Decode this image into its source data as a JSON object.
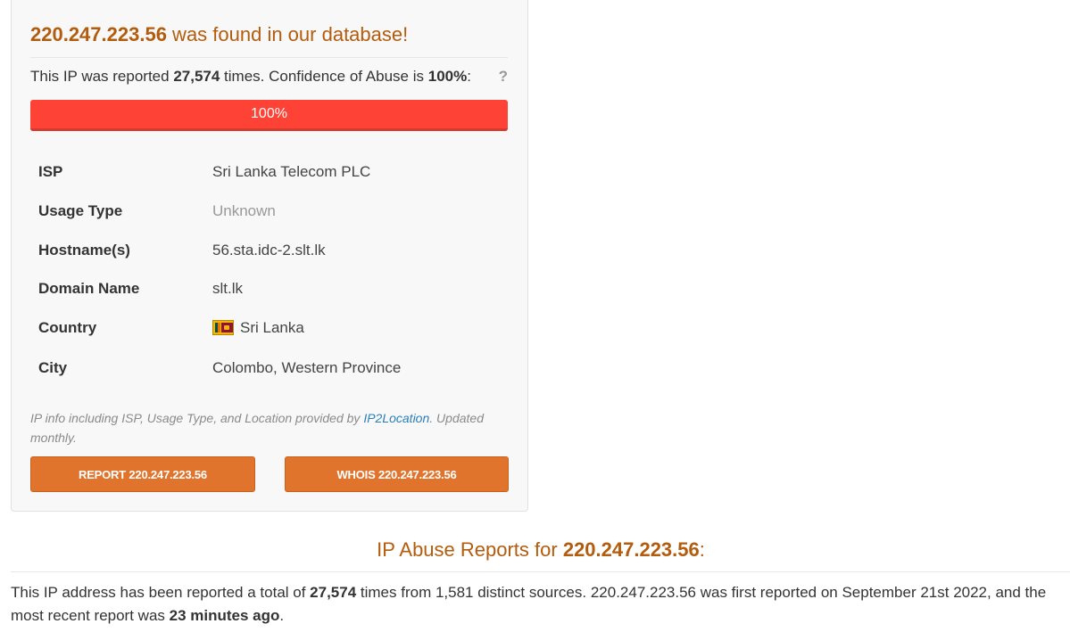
{
  "header": {
    "ip": "220.247.223.56",
    "found_text": " was found in our database!"
  },
  "confidence": {
    "prefix": "This IP was reported ",
    "report_count": "27,574",
    "middle": " times. Confidence of Abuse is ",
    "percent": "100%",
    "suffix": ":",
    "help_label": "?",
    "bar_label": "100%",
    "bar_fraction": 1.0,
    "bar_color": "#ff4236"
  },
  "info": {
    "isp": {
      "label": "ISP",
      "value": "Sri Lanka Telecom PLC"
    },
    "usage_type": {
      "label": "Usage Type",
      "value": "Unknown"
    },
    "hostnames": {
      "label": "Hostname(s)",
      "value": "56.sta.idc-2.slt.lk"
    },
    "domain": {
      "label": "Domain Name",
      "value": "slt.lk"
    },
    "country": {
      "label": "Country",
      "value": "Sri Lanka",
      "flag_icon": "sri-lanka-flag-icon"
    },
    "city": {
      "label": "City",
      "value": "Colombo, Western Province"
    }
  },
  "provider_note": {
    "prefix": "IP info including ISP, Usage Type, and Location provided by ",
    "link_text": "IP2Location",
    "suffix": ". Updated monthly."
  },
  "buttons": {
    "report": "REPORT 220.247.223.56",
    "whois": "WHOIS 220.247.223.56",
    "color": "#e0742d"
  },
  "reports": {
    "heading_prefix": "IP Abuse Reports for ",
    "heading_ip": "220.247.223.56",
    "heading_suffix": ":",
    "summary_prefix": "This IP address has been reported a total of ",
    "summary_count": "27,574",
    "summary_middle": " times from 1,581 distinct sources. 220.247.223.56 was first reported on September 21st 2022, and the most recent report was ",
    "summary_recent": "23 minutes ago",
    "summary_end": "."
  },
  "colors": {
    "accent": "#b35c0d",
    "link": "#2a7fb8"
  }
}
